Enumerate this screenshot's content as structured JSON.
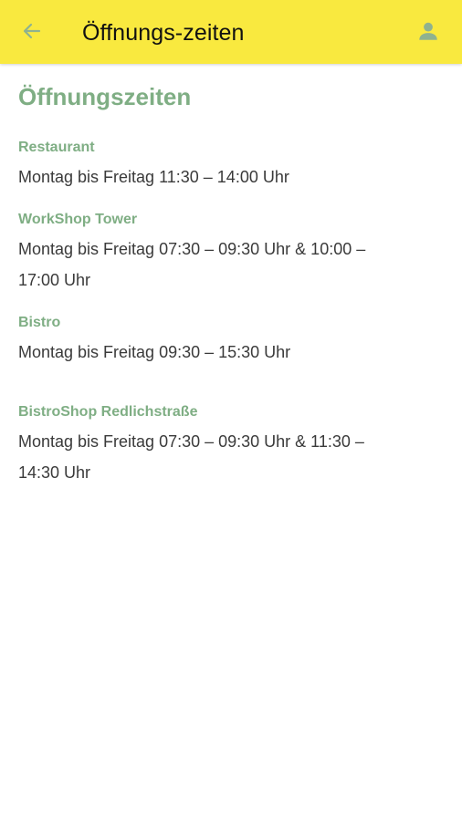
{
  "app_bar": {
    "title": "Öffnungs-zeiten",
    "back_icon": "arrow-left-icon",
    "user_icon": "user-icon"
  },
  "page": {
    "heading": "Öffnungszeiten"
  },
  "sections": [
    {
      "title": "Restaurant",
      "text": "Montag bis Freitag 11:30 – 14:00 Uhr"
    },
    {
      "title": "WorkShop Tower",
      "text": "Montag bis Freitag 07:30 – 09:30 Uhr & 10:00 – 17:00 Uhr"
    },
    {
      "title": "Bistro",
      "text": "Montag bis Freitag 09:30 – 15:30 Uhr"
    },
    {
      "title": "BistroShop Redlichstraße",
      "text": "Montag bis Freitag 07:30 – 09:30 Uhr & 11:30 – 14:30 Uhr"
    }
  ],
  "colors": {
    "app_bar_bg": "#f9e93f",
    "accent_green": "#7fae84",
    "body_text": "#3a3a3a"
  }
}
